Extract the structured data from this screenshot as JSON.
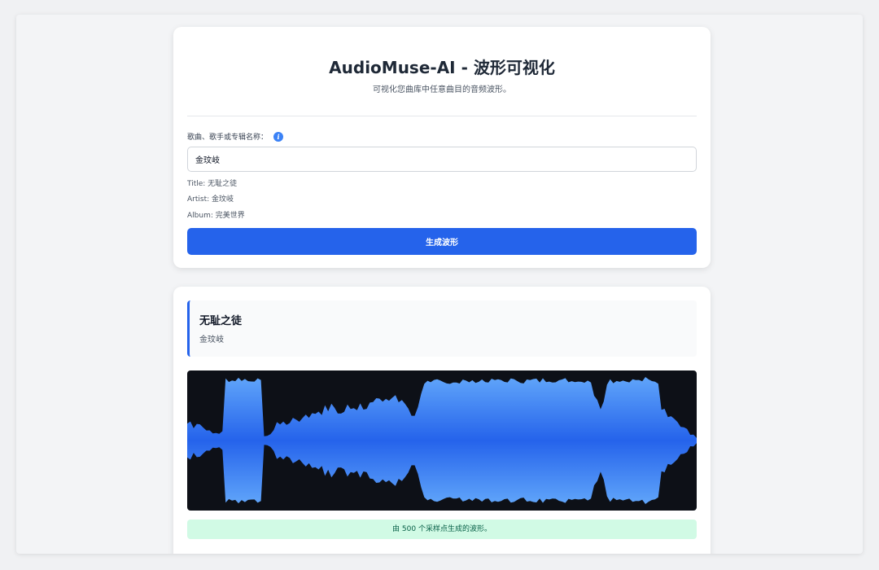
{
  "header": {
    "title": "AudioMuse-AI - 波形可视化",
    "subtitle": "可视化您曲库中任意曲目的音频波形。"
  },
  "search": {
    "label": "歌曲、歌手或专辑名称：",
    "value": "金玟岐",
    "info_icon": "info-icon"
  },
  "selection": {
    "title_line": "Title: 无耻之徒",
    "artist_line": "Artist: 金玟岐",
    "album_line": "Album: 完美世界"
  },
  "actions": {
    "generate_label": "生成波形"
  },
  "track": {
    "title": "无耻之徒",
    "artist": "金玟岐"
  },
  "waveform": {
    "sample_count": 500,
    "status": "由 500 个采样点生成的波形。",
    "colors": {
      "background": "#0d1017",
      "fill_top": "#60a5fa",
      "fill_mid": "#2563eb"
    },
    "envelope": [
      0.29,
      0.32,
      0.23,
      0.3,
      0.28,
      0.22,
      0.19,
      0.16,
      0.12,
      0.13,
      0.12,
      0.15,
      0.98,
      0.97,
      0.96,
      0.97,
      0.99,
      0.98,
      0.98,
      0.95,
      0.97,
      0.98,
      0.96,
      0.93,
      0.08,
      0.08,
      0.1,
      0.19,
      0.32,
      0.27,
      0.31,
      0.28,
      0.32,
      0.35,
      0.36,
      0.34,
      0.38,
      0.46,
      0.42,
      0.44,
      0.47,
      0.51,
      0.48,
      0.55,
      0.53,
      0.58,
      0.56,
      0.49,
      0.45,
      0.5,
      0.58,
      0.52,
      0.6,
      0.55,
      0.64,
      0.58,
      0.6,
      0.66,
      0.63,
      0.7,
      0.65,
      0.69,
      0.72,
      0.68,
      0.74,
      0.72,
      0.66,
      0.7,
      0.66,
      0.58,
      0.4,
      0.46,
      0.6,
      0.75,
      0.88,
      0.92,
      0.9,
      0.94,
      0.96,
      0.95,
      0.93,
      0.95,
      0.92,
      0.94,
      0.95,
      0.92,
      0.96,
      0.94,
      0.95,
      0.93,
      0.96,
      0.95,
      0.97,
      0.94,
      0.96,
      0.95,
      0.97,
      0.95,
      0.96,
      0.94,
      0.96,
      0.97,
      0.95,
      0.97,
      0.96,
      0.94,
      0.96,
      0.95,
      0.97,
      0.96,
      0.95,
      0.97,
      0.96,
      0.98,
      0.96,
      0.97,
      0.96,
      0.95,
      0.97,
      0.96,
      0.95,
      0.97,
      0.96,
      0.94,
      0.96,
      0.97,
      0.95,
      0.8,
      0.65,
      0.58,
      0.72,
      0.93,
      0.97,
      0.95,
      0.96,
      0.97,
      0.96,
      0.95,
      0.97,
      0.96,
      0.97,
      0.95,
      0.96,
      0.98,
      0.96,
      0.94,
      0.96,
      0.92,
      0.58,
      0.5,
      0.44,
      0.46,
      0.4,
      0.33,
      0.26,
      0.22,
      0.2,
      0.1,
      0.1,
      0.04
    ]
  }
}
